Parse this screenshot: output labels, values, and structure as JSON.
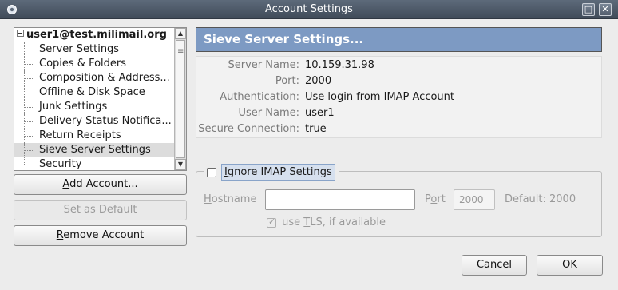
{
  "window": {
    "title": "Account Settings",
    "max_icon": "maximize-icon",
    "close_icon": "close-icon"
  },
  "tree": {
    "account": "user1@test.milimail.org",
    "items": [
      {
        "label": "Server Settings"
      },
      {
        "label": "Copies & Folders"
      },
      {
        "label": "Composition & Address..."
      },
      {
        "label": "Offline & Disk Space"
      },
      {
        "label": "Junk Settings"
      },
      {
        "label": "Delivery Status Notifica..."
      },
      {
        "label": "Return Receipts"
      },
      {
        "label": "Sieve Server Settings",
        "selected": true
      },
      {
        "label": "Security"
      }
    ]
  },
  "buttons": {
    "add_account": {
      "pre": "",
      "key": "A",
      "post": "dd Account..."
    },
    "set_default": "Set as Default",
    "remove_account": {
      "pre": "",
      "key": "R",
      "post": "emove Account"
    },
    "cancel": "Cancel",
    "ok": "OK"
  },
  "panel": {
    "title": "Sieve Server Settings...",
    "info": [
      {
        "label": "Server Name:",
        "value": "10.159.31.98"
      },
      {
        "label": "Port:",
        "value": "2000"
      },
      {
        "label": "Authentication:",
        "value": "Use login from IMAP Account"
      },
      {
        "label": "User Name:",
        "value": "user1"
      },
      {
        "label": "Secure Connection:",
        "value": "true"
      }
    ]
  },
  "imap": {
    "ignore": {
      "key": "I",
      "rest": "gnore IMAP Settings",
      "checked": false
    },
    "hostname": {
      "key": "H",
      "rest": "ostname",
      "value": ""
    },
    "port": {
      "pre": "P",
      "key": "o",
      "post": "rt",
      "value": "2000"
    },
    "default_text": "Default: 2000",
    "tls": {
      "pre": "use ",
      "key": "T",
      "post": "LS, if available",
      "checked": true
    }
  }
}
